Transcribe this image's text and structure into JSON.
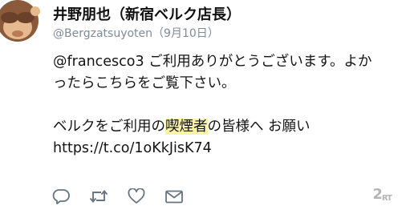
{
  "tweet": {
    "display_name": "井野朋也（新宿ベルク店長）",
    "handle": "@Bergzatsuyoten",
    "date": "（9月10日）",
    "lines": {
      "l1": "@francesco3 ご利用ありがとうございます。よか",
      "l2": "ったらこちらをご覧下さい。",
      "l3_pre": "ベルクをご利用の",
      "l3_hl1": "喫煙者",
      "l3_post": "の皆様へ お願い",
      "l4": "https://t.co/1oKkJisK74"
    }
  },
  "actions": {
    "reply_icon": "reply-icon",
    "retweet_icon": "retweet-icon",
    "like_icon": "heart-icon",
    "dm_icon": "envelope-icon"
  },
  "watermark": {
    "main": "2",
    "sub": "RT"
  },
  "colors": {
    "highlight": "#fbf3a7",
    "icon": "#66757f",
    "muted": "#7f8b96"
  }
}
